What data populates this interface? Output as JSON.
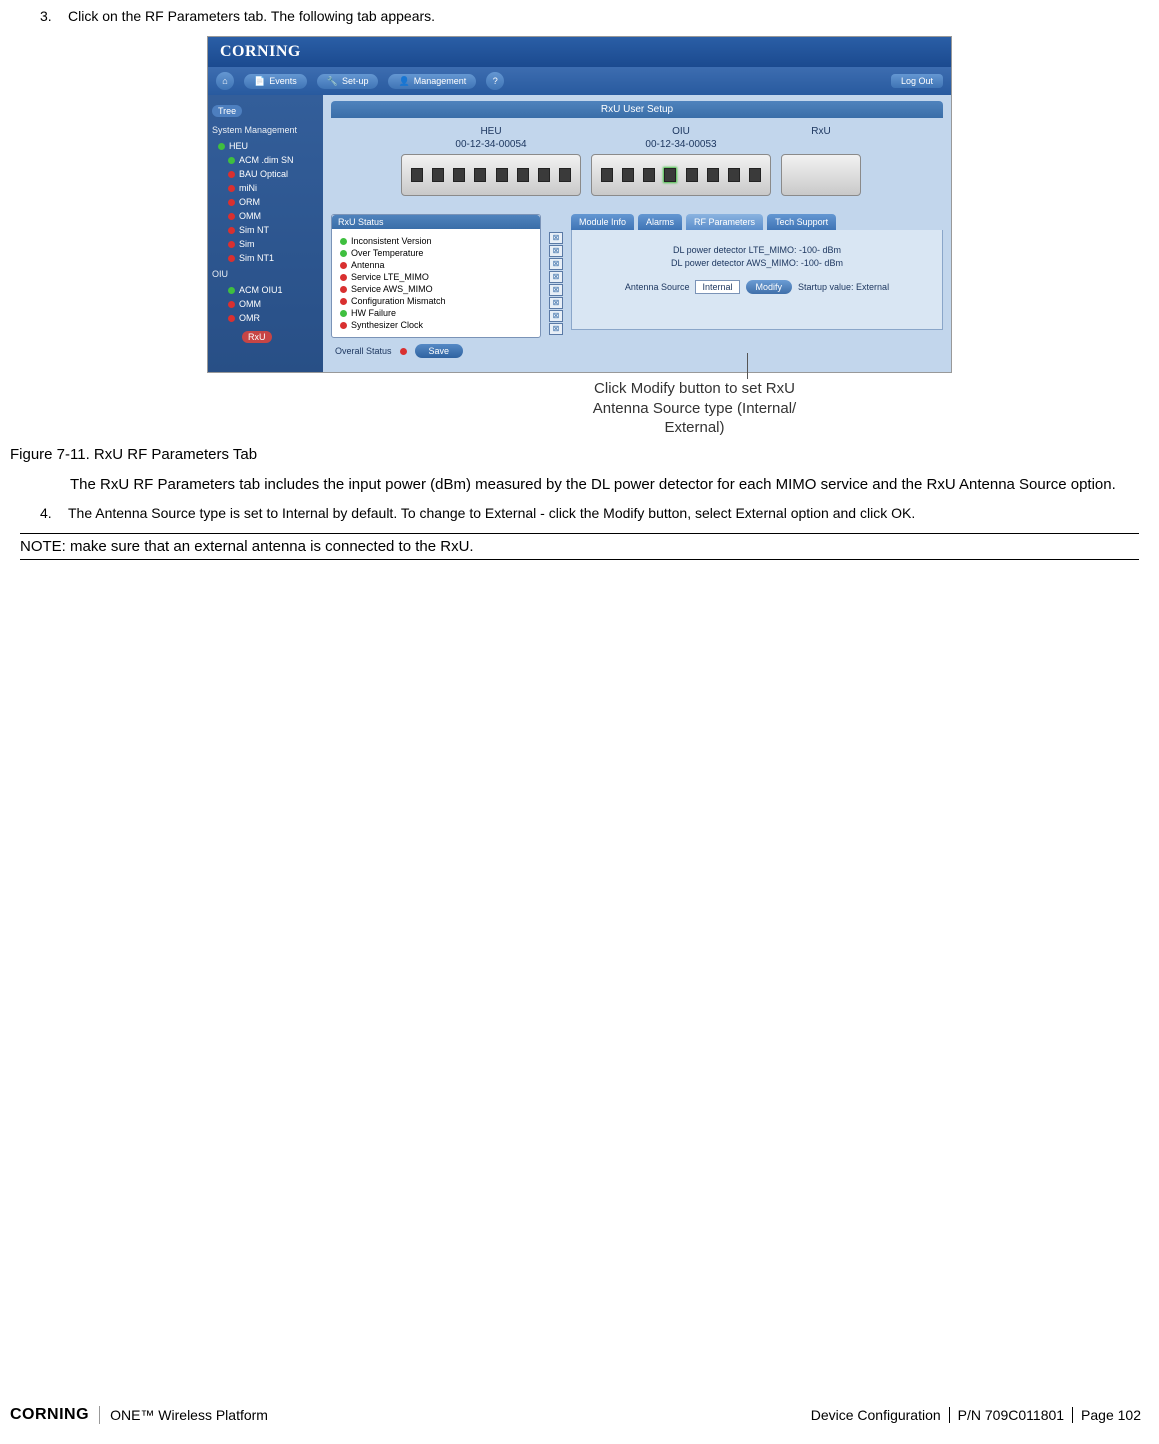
{
  "step3": {
    "num": "3.",
    "text": "Click on the RF Parameters tab. The following tab appears."
  },
  "app": {
    "brand": "CORNING",
    "menu": {
      "events": "Events",
      "setup": "Set-up",
      "management": "Management",
      "help": "Help"
    },
    "logout": "Log Out",
    "sidebar": {
      "pill": "Tree",
      "head1": "System Management",
      "heu": "HEU",
      "items1": [
        "ACM .dim SN",
        "BAU Optical",
        "miNi",
        "ORM",
        "OMM",
        "Sim NT",
        "Sim",
        "Sim NT1"
      ],
      "head2": "OIU",
      "oiu_item": "ACM OIU1",
      "oiu_sub1": "OMM",
      "oiu_sub2": "OMR",
      "rxu": "RxU"
    },
    "pane_title": "RxU User Setup",
    "hw": {
      "heu_label": "HEU",
      "heu_serial": "00-12-34-00054",
      "oiu_label": "OIU",
      "oiu_serial": "00-12-34-00053",
      "rxu_label": "RxU"
    },
    "status_head": "RxU Status",
    "status": [
      "Inconsistent Version",
      "Over Temperature",
      "Antenna",
      "Service LTE_MIMO",
      "Service AWS_MIMO",
      "Configuration Mismatch",
      "HW Failure",
      "Synthesizer Clock"
    ],
    "status_colors": [
      "green",
      "green",
      "red",
      "red",
      "red",
      "red",
      "green",
      "red"
    ],
    "tabs": {
      "t1": "Module Info",
      "t2": "Alarms",
      "t3": "RF Parameters",
      "t4": "Tech Support"
    },
    "params": {
      "l1": "DL power detector LTE_MIMO: -100- dBm",
      "l2": "DL power detector AWS_MIMO: -100- dBm",
      "src_label": "Antenna Source",
      "src_val": "Internal",
      "modify": "Modify",
      "startup": "Startup value: External"
    },
    "overall": "Overall Status",
    "save": "Save"
  },
  "annotation": {
    "l1": "Click Modify button to set RxU",
    "l2": "Antenna Source type (Internal/",
    "l3": "External)"
  },
  "fig_caption": "Figure 7-11. RxU RF Parameters Tab",
  "para1": "The RxU RF Parameters tab includes the input power (dBm) measured by the DL power detector for each MIMO service and the RxU Antenna Source option.",
  "step4": {
    "num": "4.",
    "text": "The Antenna Source type is set to Internal by default. To change to External - click the Modify button, select External option and click OK."
  },
  "note": "NOTE: make sure that an external antenna is connected to the RxU.",
  "footer": {
    "brand": "CORNING",
    "platform": "ONE™ Wireless Platform",
    "section": "Device Configuration",
    "pn": "P/N 709C011801",
    "page": "Page 102"
  }
}
